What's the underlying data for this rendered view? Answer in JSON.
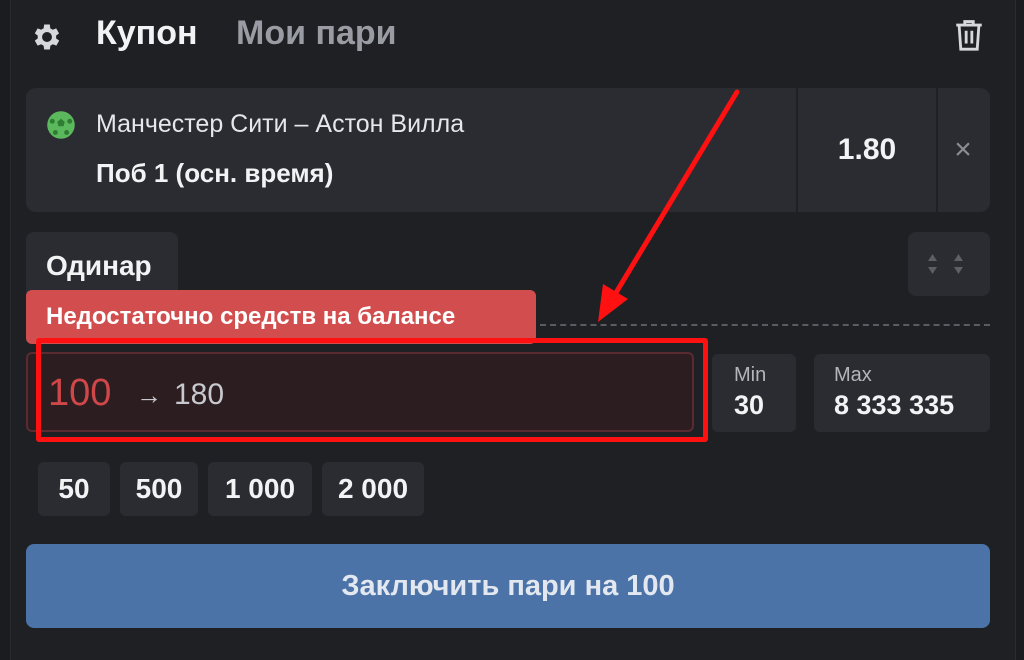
{
  "header": {
    "tab_coupon": "Купон",
    "tab_my_bets": "Мои пари"
  },
  "event": {
    "match": "Манчестер Сити – Астон Вилла",
    "outcome": "Поб 1 (осн. время)",
    "odds": "1.80",
    "remove_icon": "×"
  },
  "bet_type": {
    "label": "Одинар"
  },
  "error": {
    "message": "Недостаточно средств на балансе"
  },
  "stake": {
    "value": "100",
    "arrow": "→",
    "potential_win": "180"
  },
  "limits": {
    "min_label": "Min",
    "min_value": "30",
    "max_label": "Max",
    "max_value": "8 333 335"
  },
  "quick_amounts": [
    "50",
    "500",
    "1 000",
    "2 000"
  ],
  "submit": {
    "label": "Заключить пари на 100"
  },
  "colors": {
    "error": "#d24e4e",
    "submit": "#4b73a8",
    "annotation": "#ff1111",
    "ball": "#5cb85c"
  },
  "icons": [
    "gear-icon",
    "trash-icon",
    "football-icon",
    "close-icon",
    "sort-arrows-icon"
  ]
}
